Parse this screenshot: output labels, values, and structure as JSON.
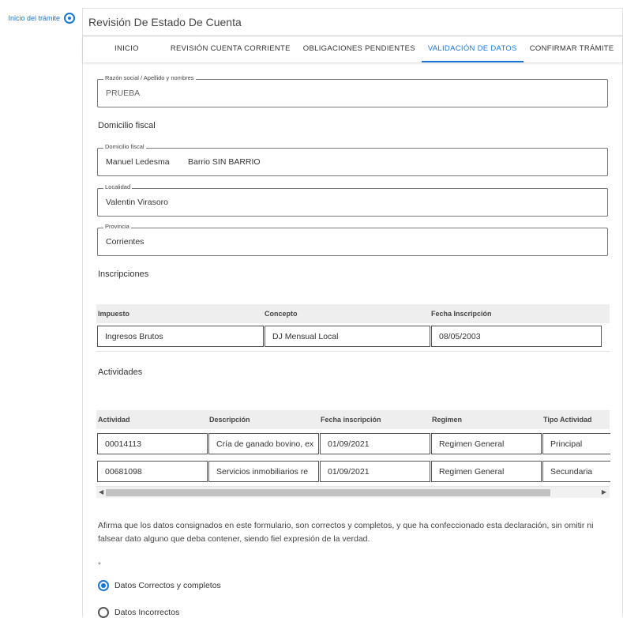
{
  "stepper": {
    "current_step_label": "Inicio del trámite"
  },
  "card": {
    "title": "Revisión De Estado De Cuenta"
  },
  "tabs": [
    {
      "label": "INICIO"
    },
    {
      "label": "REVISIÓN CUENTA CORRIENTE"
    },
    {
      "label": "OBLIGACIONES PENDIENTES"
    },
    {
      "label": "VALIDACIÓN DE DATOS",
      "active": true
    },
    {
      "label": "CONFIRMAR TRÁMITE"
    }
  ],
  "accent_color": "#1976d2",
  "razon_social": {
    "label": "Razón social / Apellido y nombres",
    "value": "PRUEBA"
  },
  "domicilio_section_title": "Domicilio fiscal",
  "domicilio": {
    "label": "Domicilio fiscal",
    "value_street": "Manuel Ledesma",
    "value_barrio": "Barrio SIN BARRIO"
  },
  "localidad": {
    "label": "Localidad",
    "value": "Valentin Virasoro"
  },
  "provincia": {
    "label": "Provincia",
    "value": "Corrientes"
  },
  "inscripciones": {
    "title": "Inscripciones",
    "headers": [
      "Impuesto",
      "Concepto",
      "Fecha Inscripción"
    ],
    "rows": [
      [
        "Ingresos Brutos",
        "DJ Mensual Local",
        "08/05/2003"
      ]
    ]
  },
  "actividades": {
    "title": "Actividades",
    "headers": [
      "Actividad",
      "Descripción",
      "Fecha inscripción",
      "Regimen",
      "Tipo Actividad"
    ],
    "rows": [
      [
        "00014113",
        "Cría de ganado bovino, ex",
        "01/09/2021",
        "Regimen General",
        "Principal"
      ],
      [
        "00681098",
        "Servicios inmobiliarios re",
        "01/09/2021",
        "Regimen General",
        "Secundaria"
      ]
    ]
  },
  "declaration": {
    "line1": "Afirma que los datos consignados en este formulario, son correctos y completos, y que ha confeccionado esta declaración, sin omitir ni",
    "line2": "falsear dato alguno que deba contener, siendo fiel expresión de la verdad.",
    "required_mark": "*"
  },
  "options": [
    {
      "label": "Datos Correctos y completos",
      "checked": true
    },
    {
      "label": "Datos Incorrectos",
      "checked": false
    }
  ]
}
